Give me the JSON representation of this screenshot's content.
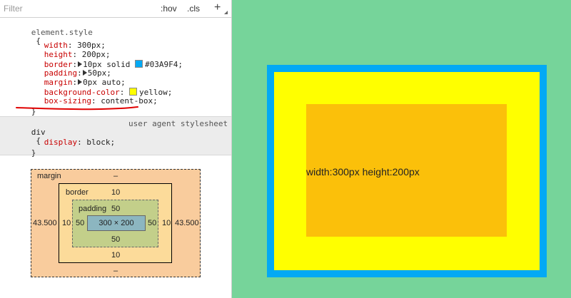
{
  "filter": {
    "placeholder": "Filter",
    "hov_label": ":hov",
    "cls_label": ".cls",
    "add_label": "+"
  },
  "element_style": {
    "selector": "element.style",
    "open_brace": "{",
    "close_brace": "}",
    "declarations": [
      {
        "prop": "width",
        "value": "300px;"
      },
      {
        "prop": "height",
        "value": "200px;"
      },
      {
        "prop": "border",
        "value": "10px solid ",
        "color_value": "#03A9F4;",
        "swatch_color": "#03A9F4"
      },
      {
        "prop": "padding",
        "value": "50px;"
      },
      {
        "prop": "margin",
        "value": "0px auto;"
      },
      {
        "prop": "background-color",
        "value": "yellow;",
        "swatch_color": "#ffff00"
      },
      {
        "prop": "box-sizing",
        "value": "content-box;"
      }
    ]
  },
  "user_agent_rule": {
    "selector": "div",
    "open_brace": "{",
    "close_brace": "}",
    "source": "user agent stylesheet",
    "declarations": [
      {
        "prop": "display",
        "value": "block;"
      }
    ]
  },
  "box_model": {
    "margin_label": "margin",
    "margin_top": "–",
    "margin_bottom": "–",
    "margin_left": "43.500",
    "margin_right": "43.500",
    "border_label": "border",
    "border_top": "10",
    "border_bottom": "10",
    "border_left": "10",
    "border_right": "10",
    "padding_label": "padding",
    "padding_top": "50",
    "padding_bottom": "50",
    "padding_left": "50",
    "padding_right": "50",
    "content_size": "300 × 200"
  },
  "preview": {
    "text": "width:300px height:200px"
  },
  "colors": {
    "preview_background": "#76D49A",
    "border_color": "#03A9F4",
    "box_background": "#FFFF00",
    "content_background": "#FBC00A",
    "annotation_underline": "#E00000"
  }
}
